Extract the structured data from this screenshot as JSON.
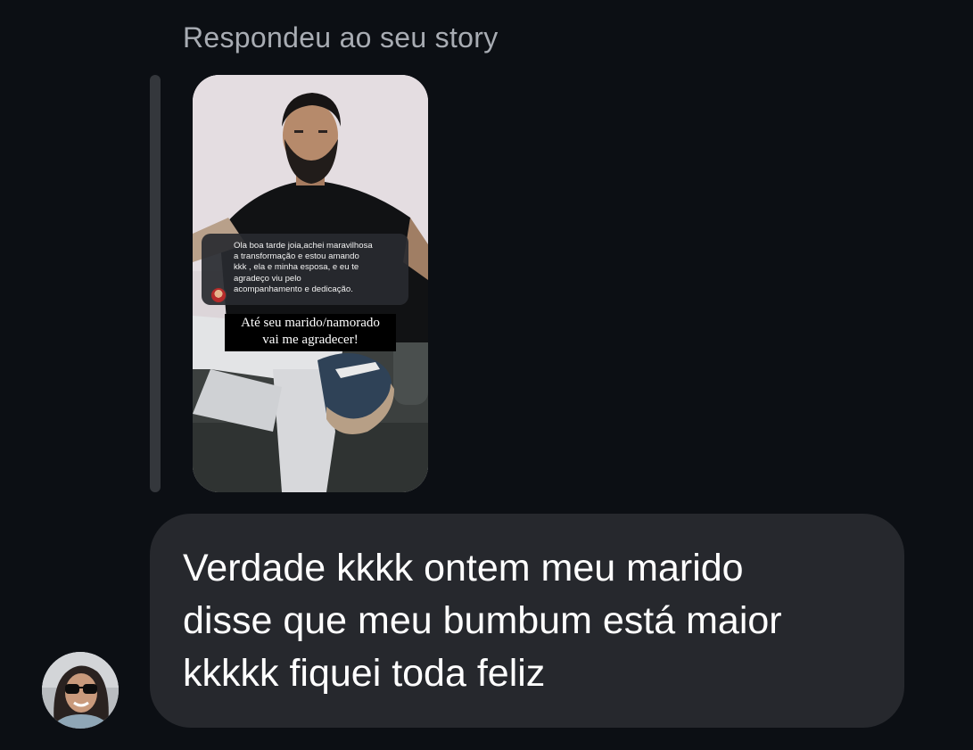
{
  "thread": {
    "reply_caption": "Respondeu ao seu story"
  },
  "story": {
    "quoted_message": "Ola boa tarde joia,achei maravilhosa\na transformação e estou amando\nkkk , ela e minha esposa, e eu te\nagradeço viu pelo\nacompanhamento e dedicação.",
    "caption": "Até seu marido/namorado\nvai me agradecer!"
  },
  "message": {
    "text": "Verdade kkkk ontem meu marido\ndisse que meu bumbum está maior\nkkkkk fiquei toda feliz"
  },
  "colors": {
    "background": "#0c0f14",
    "bubble": "#26282d",
    "caption_text": "#a8acb3",
    "reply_bar": "#34373c"
  }
}
